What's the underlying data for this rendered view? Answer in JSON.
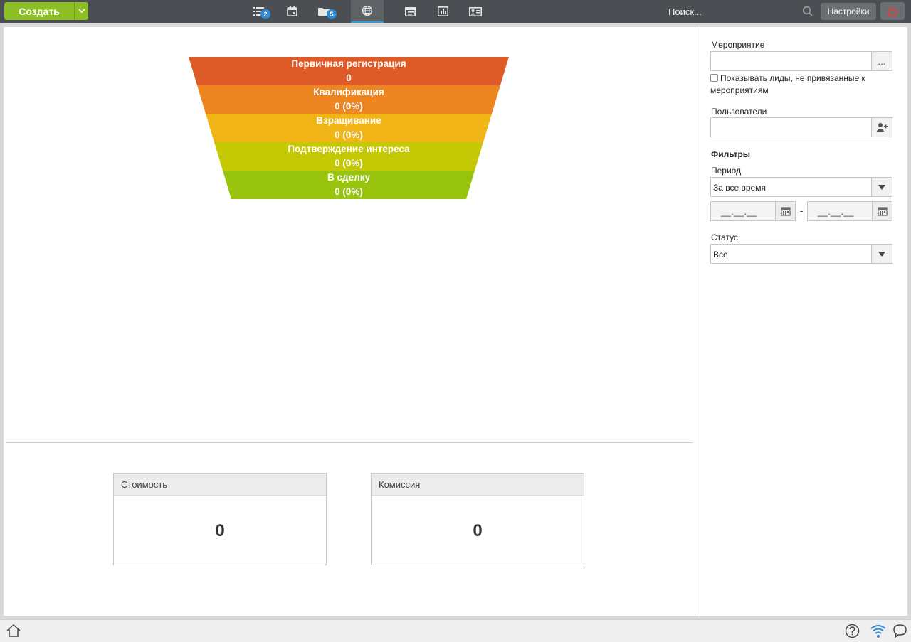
{
  "topbar": {
    "create_label": "Создать",
    "badges": {
      "tasks": "2",
      "folders": "5"
    },
    "search_placeholder": "Поиск...",
    "settings_label": "Настройки"
  },
  "funnel": {
    "stages": [
      {
        "name": "Первичная регистрация",
        "value": "0",
        "color": "#de5b27"
      },
      {
        "name": "Квалификация",
        "value": "0 (0%)",
        "color": "#ed8521"
      },
      {
        "name": "Взращивание",
        "value": "0 (0%)",
        "color": "#f2b518"
      },
      {
        "name": "Подтверждение интереса",
        "value": "0 (0%)",
        "color": "#c5c804"
      },
      {
        "name": "В сделку",
        "value": "0 (0%)",
        "color": "#98c40e"
      }
    ]
  },
  "cards": {
    "cost": {
      "title": "Стоимость",
      "value": "0"
    },
    "commission": {
      "title": "Комиссия",
      "value": "0"
    }
  },
  "filters": {
    "event_label": "Мероприятие",
    "event_button": "...",
    "show_unlinked_label": "Показывать лиды, не привязанные к мероприятиям",
    "users_label": "Пользователи",
    "filters_heading": "Фильтры",
    "period_label": "Период",
    "period_value": "За все время",
    "date_from": "__.__.__",
    "date_to": "__.__.__",
    "date_separator": "-",
    "status_label": "Статус",
    "status_value": "Все"
  },
  "colors": {
    "topbar": "#4b4f53",
    "create_button": "#8cbf26",
    "accent": "#2b9cd8",
    "power": "#e0453a"
  }
}
